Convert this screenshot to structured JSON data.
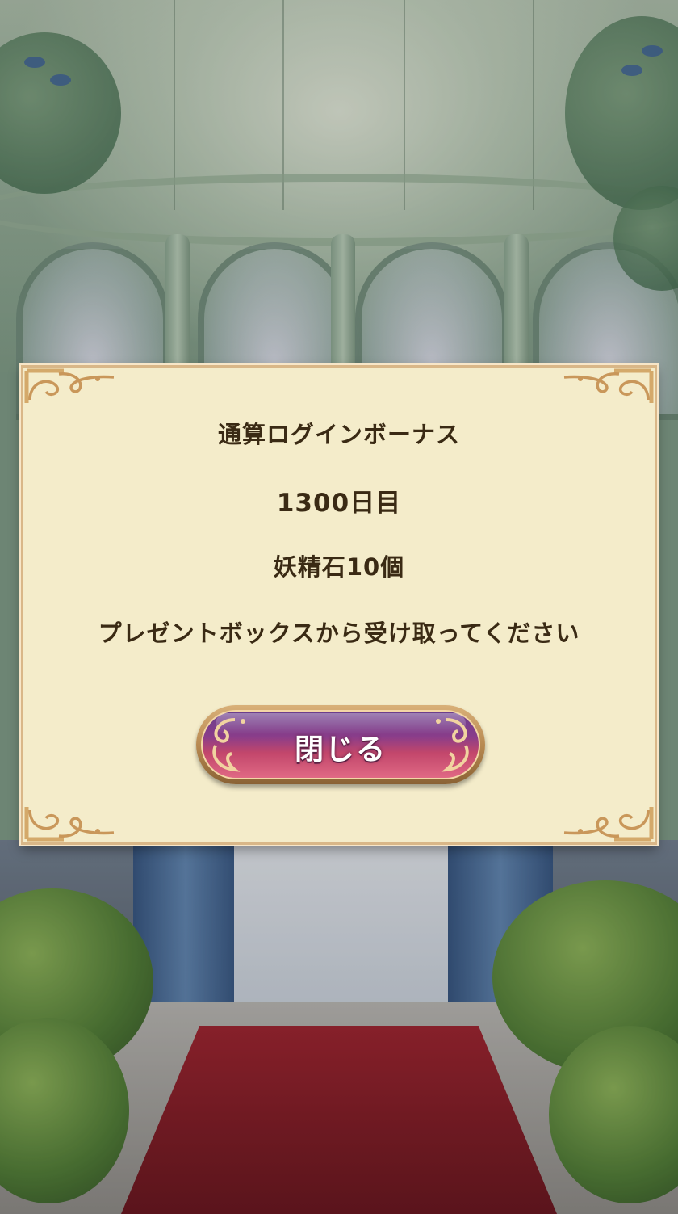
{
  "dialog": {
    "title": "通算ログインボーナス",
    "day": "1300日目",
    "reward": "妖精石10個",
    "note": "プレゼントボックスから受け取ってください",
    "close_label": "閉じる"
  },
  "colors": {
    "panel_background": "#f4ecca",
    "panel_border": "#d9b788",
    "text": "#3a2a14",
    "button_top": "#6a3e8c",
    "button_bottom": "#e06984",
    "carpet": "#9c1f2b"
  },
  "icons": {
    "frame_ornament": "gold-scroll-ornament-icon",
    "button_ornament": "gold-swirl-icon"
  }
}
